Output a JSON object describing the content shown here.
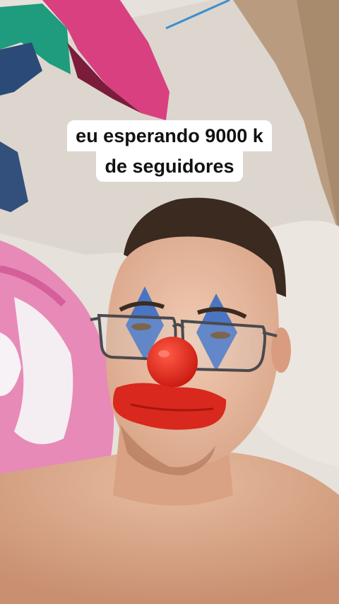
{
  "caption": {
    "line1": "eu esperando 9000 k",
    "line2": "de seguidores"
  },
  "photo": {
    "subject": "selfie-with-clown-face-filter",
    "colors": {
      "wall": "#e9e5de",
      "skin": "#e3b89d",
      "hair": "#3a2a1f",
      "clown_red": "#e0241b",
      "clown_blue": "#3d6fc4",
      "blanket_pink": "#e97fb0"
    }
  }
}
